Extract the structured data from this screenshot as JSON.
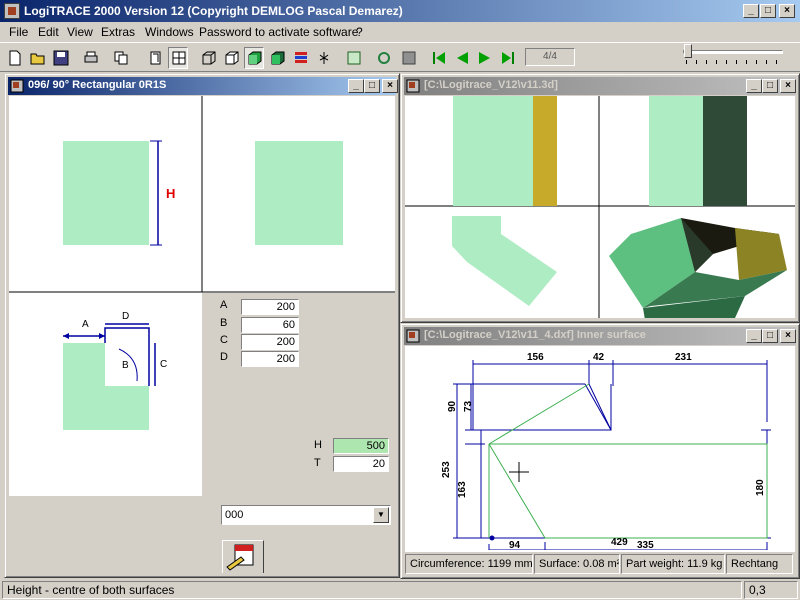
{
  "app": {
    "title": "LogiTRACE 2000  Version 12  (Copyright DEMLOG Pascal Demarez)",
    "menu": [
      "File",
      "Edit",
      "View",
      "Extras",
      "Windows",
      "Password to activate software",
      "?"
    ],
    "page_indicator": "4/4"
  },
  "window_controls": {
    "minimize": "_",
    "maximize": "□",
    "close": "×"
  },
  "toolbar_icons": [
    "new-icon",
    "open-icon",
    "save-icon",
    "print-icon",
    "copy-icon",
    "view-2d-icon",
    "view-split-icon",
    "box-outline-icon",
    "box-wire-icon",
    "box-shaded-green-icon",
    "box-shaded-icon",
    "color-bars-icon",
    "tree-icon",
    "frame-icon",
    "rotate-icon",
    "info-icon",
    "first-icon",
    "prev-icon",
    "next-icon",
    "last-icon"
  ],
  "params_window": {
    "title": "096/ 90° Rectangular 0R1S",
    "h_marker": "H",
    "diagram_labels": {
      "a": "A",
      "b": "B",
      "c": "C",
      "d": "D"
    },
    "fields": [
      {
        "label": "A",
        "value": "200"
      },
      {
        "label": "B",
        "value": "60"
      },
      {
        "label": "C",
        "value": "200"
      },
      {
        "label": "D",
        "value": "200"
      }
    ],
    "h_field": {
      "label": "H",
      "value": "500"
    },
    "t_field": {
      "label": "T",
      "value": "20"
    },
    "combo_value": "000"
  },
  "view3d_window": {
    "title": "[C:\\Logitrace_V12\\v11.3d]"
  },
  "dxf_window": {
    "title": "[C:\\Logitrace_V12\\v11_4.dxf]  Inner surface",
    "dims": {
      "top_1": "156",
      "top_2": "42",
      "top_3": "231",
      "left_90": "90",
      "left_73": "73",
      "left_253": "253",
      "left_163": "163",
      "right_180": "180",
      "bottom_94": "94",
      "bottom_335": "335",
      "bottom_429": "429"
    },
    "info": {
      "circumference": "Circumference: 1199 mm",
      "surface": "Surface: 0.08 m²",
      "weight": "Part weight: 11.9 kg",
      "shape": "Rechtang"
    }
  },
  "status": {
    "message": "Height - centre of both surfaces",
    "coords": "0,3"
  },
  "colors": {
    "part_green": "#aeecc4",
    "dark_green": "#2f4a36",
    "yellow": "#c8aa2a",
    "dim_blue": "#0000a0",
    "outline_green": "#3cb050"
  }
}
